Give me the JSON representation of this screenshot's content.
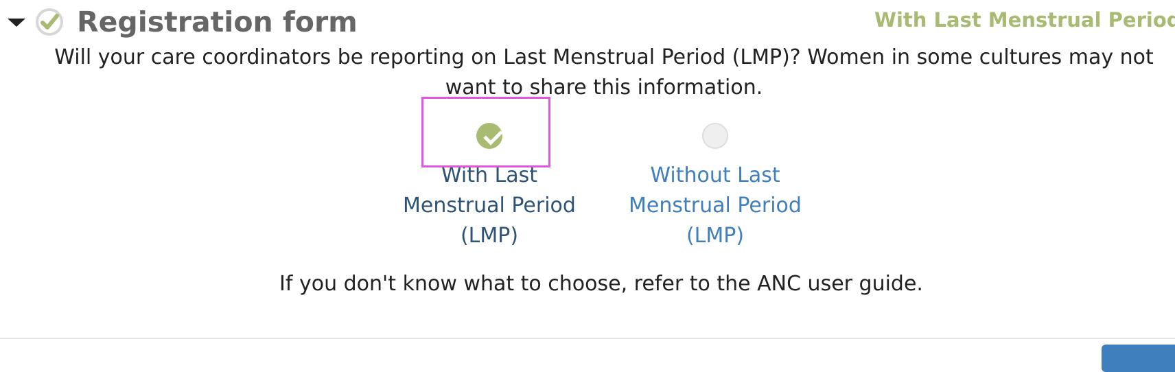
{
  "header": {
    "title": "Registration form",
    "summary": "With Last Menstrual Period (LMP)"
  },
  "question": {
    "text": "Will your care coordinators be reporting on Last Menstrual Period (LMP)? Women in some cultures may not want to share this information."
  },
  "options": [
    {
      "label": "With Last Menstrual Period (LMP)",
      "selected": true
    },
    {
      "label": "Without Last Menstrual Period (LMP)",
      "selected": false
    }
  ],
  "help": {
    "text": "If you don't know what to choose, refer to the ANC user guide."
  },
  "icons": {
    "collapse": "caret-down-icon",
    "status": "check-circle-icon"
  },
  "colors": {
    "accent": "#a9bb72",
    "title": "#666666",
    "link": "#3f7fbd",
    "selected_label": "#2e5377",
    "highlight": "#e257e2"
  }
}
